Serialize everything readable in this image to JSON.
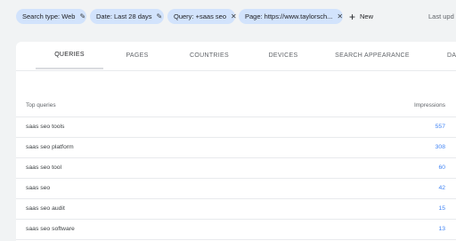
{
  "filters": {
    "chips": [
      {
        "label": "Search type: Web",
        "icon": "pencil-icon"
      },
      {
        "label": "Date: Last 28 days",
        "icon": "pencil-icon"
      },
      {
        "label": "Query: +saas seo",
        "icon": "close-icon"
      },
      {
        "label": "Page: https://www.taylorsch...",
        "icon": "close-icon"
      }
    ],
    "new_label": "New",
    "last_update": "Last upd"
  },
  "tabs": [
    {
      "label": "QUERIES",
      "active": true
    },
    {
      "label": "PAGES"
    },
    {
      "label": "COUNTRIES"
    },
    {
      "label": "DEVICES"
    },
    {
      "label": "SEARCH APPEARANCE"
    },
    {
      "label": "DA"
    }
  ],
  "table": {
    "columns": [
      "Top queries",
      "Impressions"
    ],
    "rows": [
      {
        "query": "saas seo tools",
        "impressions": "557"
      },
      {
        "query": "saas seo platform",
        "impressions": "308"
      },
      {
        "query": "saas seo tool",
        "impressions": "60"
      },
      {
        "query": "saas seo",
        "impressions": "42"
      },
      {
        "query": "saas seo audit",
        "impressions": "15"
      },
      {
        "query": "saas seo software",
        "impressions": "13"
      }
    ]
  },
  "colors": {
    "chip_bg": "#d2e3fc",
    "value_link": "#4285f4",
    "page_bg": "#f1f3f4"
  }
}
